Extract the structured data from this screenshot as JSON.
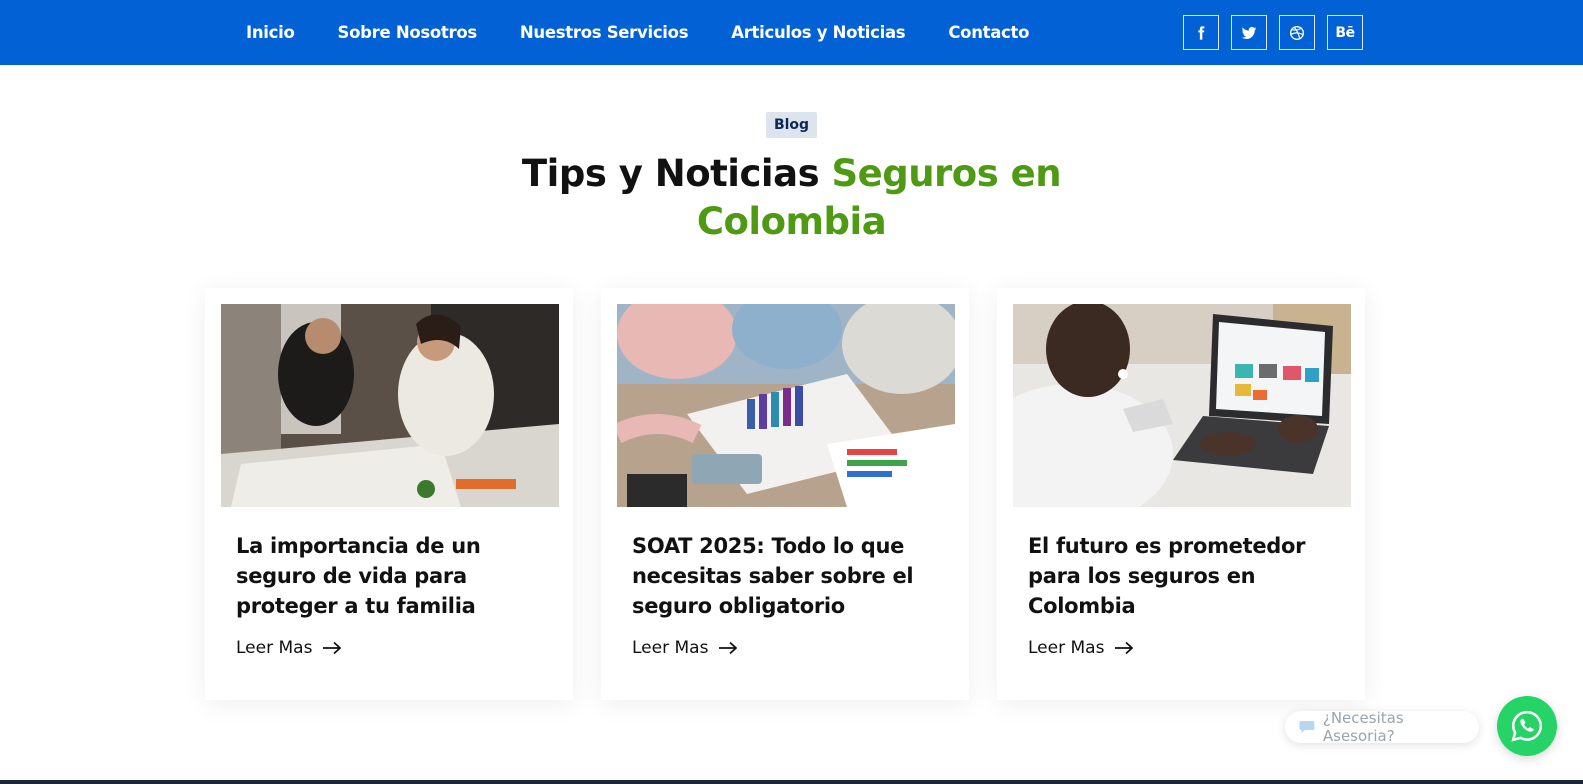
{
  "nav": {
    "items": [
      "Inicio",
      "Sobre Nosotros",
      "Nuestros Servicios",
      "Articulos y Noticias",
      "Contacto"
    ],
    "social": {
      "behance_label": "Bē"
    }
  },
  "section": {
    "badge": "Blog",
    "title_dark": "Tips y Noticias ",
    "title_accent": "Seguros en Colombia"
  },
  "cards": [
    {
      "title": "La importancia de un seguro de vida para proteger a tu familia",
      "link": "Leer Mas"
    },
    {
      "title": "SOAT 2025: Todo lo que necesitas saber sobre el seguro obligatorio",
      "link": "Leer Mas"
    },
    {
      "title": "El futuro es prometedor para los seguros en Colombia",
      "link": "Leer Mas"
    }
  ],
  "chat": {
    "prompt": "¿Necesitas Asesoria?"
  },
  "colors": {
    "nav_bg": "#0361d6",
    "accent_green": "#4e9a13",
    "whatsapp": "#25d366"
  }
}
